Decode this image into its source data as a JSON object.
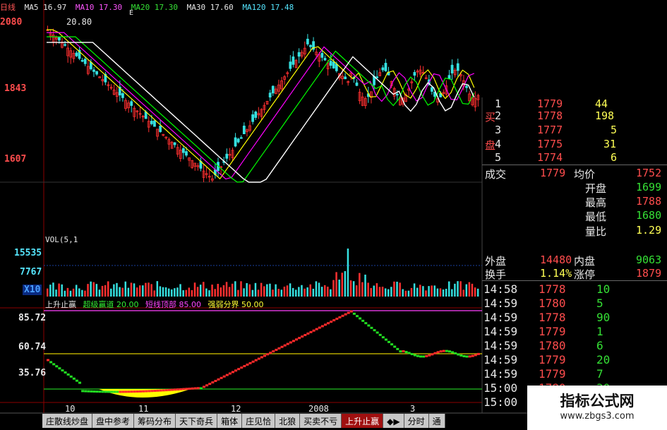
{
  "header": {
    "period": "日线",
    "ma_prefix": "MA",
    "ma5": "MA5 16.97",
    "ma10": "MA10 17.30",
    "ma20": "MA20 17.30",
    "ma30": "MA30 17.60",
    "ma120": "MA120 17.48",
    "marker": "E",
    "top_value": "20.80"
  },
  "price_axis": [
    "2080",
    "1843",
    "1607"
  ],
  "volume": {
    "label": "VOL(5,1",
    "axis": [
      "15535",
      "7767"
    ],
    "unit": "X10"
  },
  "indicator": {
    "name": "上升止赢",
    "p1": "超级赢道 20.00",
    "p2": "短线顶部 85.00",
    "p3": "强弱分界 50.00",
    "axis": [
      "85.72",
      "60.74",
      "35.76"
    ]
  },
  "x_axis": [
    "10",
    "11",
    "12",
    "2008",
    "3"
  ],
  "order_book": [
    {
      "side": "",
      "level": "1",
      "price": "1779",
      "vol": "44"
    },
    {
      "side": "买",
      "level": "2",
      "price": "1778",
      "vol": "198"
    },
    {
      "side": "",
      "level": "3",
      "price": "1777",
      "vol": "5"
    },
    {
      "side": "盘",
      "level": "4",
      "price": "1775",
      "vol": "31"
    },
    {
      "side": "",
      "level": "5",
      "price": "1774",
      "vol": "6"
    }
  ],
  "quote": {
    "deal_label": "成交",
    "deal": "1779",
    "avg_label": "均价",
    "avg": "1752",
    "open_label": "开盘",
    "open": "1699",
    "high_label": "最高",
    "high": "1788",
    "low_label": "最低",
    "low": "1680",
    "ratio_label": "量比",
    "ratio": "1.29",
    "outer_label": "外盘",
    "outer": "14480",
    "inner_label": "内盘",
    "inner": "9063",
    "turnover_label": "换手",
    "turnover": "1.14%",
    "limit_label": "涨停",
    "limit": "1879"
  },
  "ticks": [
    {
      "time": "14:58",
      "price": "1778",
      "vol": "10"
    },
    {
      "time": "14:59",
      "price": "1780",
      "vol": "5"
    },
    {
      "time": "14:59",
      "price": "1778",
      "vol": "90"
    },
    {
      "time": "14:59",
      "price": "1779",
      "vol": "1"
    },
    {
      "time": "14:59",
      "price": "1780",
      "vol": "6"
    },
    {
      "time": "14:59",
      "price": "1779",
      "vol": "20"
    },
    {
      "time": "14:59",
      "price": "1779",
      "vol": "7"
    },
    {
      "time": "15:00",
      "price": "1780",
      "vol": "30"
    },
    {
      "time": "15:00",
      "price": "",
      "vol": ""
    }
  ],
  "tabs": [
    "庄散线炒盘",
    "盘中参考",
    "筹码分布",
    "天下奇兵",
    "箱体",
    "庄见恰",
    "北狼",
    "买卖不亏",
    "上升止赢",
    "◆▶",
    "分时",
    "通"
  ],
  "watermark": {
    "title": "指标公式网",
    "url": "www.zbgs3.com"
  },
  "colors": {
    "up": "#ff3030",
    "down": "#35e0e0",
    "ma5": "#ffffff",
    "ma10": "#ffff00",
    "ma20": "#ff00ff",
    "ma30": "#00ff00",
    "ma120": "#ffffff"
  }
}
